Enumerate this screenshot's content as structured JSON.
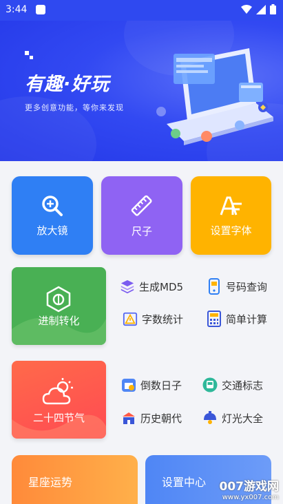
{
  "status": {
    "time": "3:44"
  },
  "banner": {
    "title": "有趣·好玩",
    "subtitle": "更多创意功能，等你来发现"
  },
  "tiles": [
    {
      "label": "放大镜",
      "color": "#2f7ff4",
      "icon": "magnifier-icon"
    },
    {
      "label": "尺子",
      "color": "#8f63f3",
      "icon": "ruler-icon"
    },
    {
      "label": "设置字体",
      "color": "#ffb300",
      "icon": "font-icon"
    }
  ],
  "section1": {
    "card_label": "进制转化",
    "card_color": "#49b054",
    "items": [
      {
        "label": "生成MD5",
        "icon": "layers-icon"
      },
      {
        "label": "号码查询",
        "icon": "phone-icon"
      },
      {
        "label": "字数统计",
        "icon": "warning-doc-icon"
      },
      {
        "label": "简单计算",
        "icon": "calculator-icon"
      }
    ]
  },
  "section2": {
    "card_label": "二十四节气",
    "card_color": "#ff5a48",
    "items": [
      {
        "label": "倒数日子",
        "icon": "calendar-icon"
      },
      {
        "label": "交通标志",
        "icon": "bus-icon"
      },
      {
        "label": "历史朝代",
        "icon": "building-icon"
      },
      {
        "label": "灯光大全",
        "icon": "lamp-icon"
      }
    ]
  },
  "bottom": [
    {
      "label": "星座运势",
      "color": "#ff9c3a"
    },
    {
      "label": "设置中心",
      "color": "#4f86f5"
    }
  ],
  "watermark": {
    "name": "007游戏网",
    "url": "www.yx007.com"
  }
}
